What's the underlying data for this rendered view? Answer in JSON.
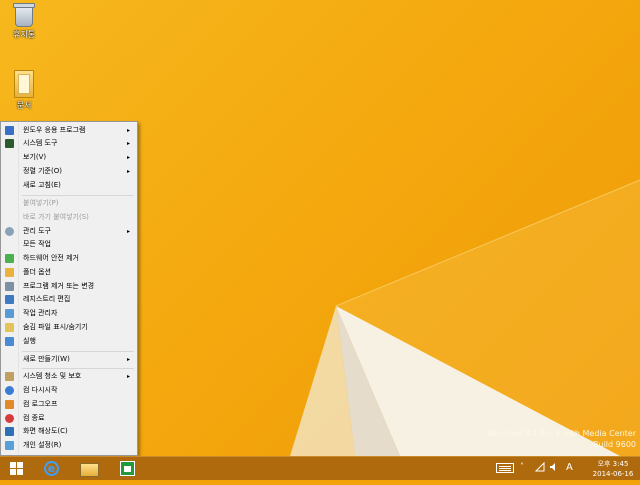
{
  "desktop": {
    "icons": [
      {
        "label": "휴지통",
        "icon": "recycle-bin-icon"
      },
      {
        "label": "문서",
        "icon": "folder-icon"
      }
    ],
    "watermark": [
      "Windows 8.1 Pro K with Media Center",
      "Build 9600"
    ]
  },
  "context_menu": {
    "items": [
      {
        "label": "윈도우 응용 프로그램",
        "icon": "windows-apps-icon",
        "submenu": true,
        "enabled": true
      },
      {
        "label": "시스템 도구",
        "icon": "system-tools-icon",
        "submenu": true,
        "enabled": true
      },
      {
        "label": "보기(V)",
        "submenu": true,
        "enabled": true
      },
      {
        "label": "정렬 기준(O)",
        "submenu": true,
        "enabled": true
      },
      {
        "label": "새로 고침(E)",
        "submenu": false,
        "enabled": true
      },
      {
        "label": "붙여넣기(P)",
        "submenu": false,
        "enabled": false
      },
      {
        "label": "바로 가기 붙여넣기(S)",
        "submenu": false,
        "enabled": false
      },
      {
        "label": "관리 도구",
        "icon": "admin-tools-icon",
        "submenu": true,
        "enabled": true
      },
      {
        "label": "모든 작업",
        "submenu": false,
        "enabled": true
      },
      {
        "label": "하드웨어 안전 제거",
        "icon": "safe-remove-hardware-icon",
        "submenu": false,
        "enabled": true
      },
      {
        "label": "폴더 옵션",
        "icon": "folder-options-icon",
        "submenu": false,
        "enabled": true
      },
      {
        "label": "프로그램 제거 또는 변경",
        "icon": "programs-icon",
        "submenu": false,
        "enabled": true
      },
      {
        "label": "레지스트리 편집",
        "icon": "registry-icon",
        "submenu": false,
        "enabled": true
      },
      {
        "label": "작업 관리자",
        "icon": "task-manager-icon",
        "submenu": false,
        "enabled": true
      },
      {
        "label": "숨김 파일 표시/숨기기",
        "icon": "hidden-files-icon",
        "submenu": false,
        "enabled": true
      },
      {
        "label": "실행",
        "icon": "run-icon",
        "submenu": false,
        "enabled": true
      },
      {
        "label": "새로 만들기(W)",
        "submenu": true,
        "enabled": true
      },
      {
        "label": "시스템 청소 및 보호",
        "icon": "shield-icon",
        "submenu": true,
        "enabled": true
      },
      {
        "label": "컴 다시시작",
        "icon": "restart-icon",
        "submenu": false,
        "enabled": true
      },
      {
        "label": "컴 로그오프",
        "icon": "logoff-icon",
        "submenu": false,
        "enabled": true
      },
      {
        "label": "컴 종료",
        "icon": "shutdown-icon",
        "submenu": false,
        "enabled": true
      },
      {
        "label": "화면 해상도(C)",
        "icon": "display-icon",
        "submenu": false,
        "enabled": true
      },
      {
        "label": "개인 설정(R)",
        "icon": "personalize-icon",
        "submenu": false,
        "enabled": true
      }
    ],
    "submenu_arrow": "▸"
  },
  "taskbar": {
    "pinned": [
      {
        "name": "start-button",
        "icon": "windows-logo-icon"
      },
      {
        "name": "internet-explorer",
        "icon": "ie-icon"
      },
      {
        "name": "file-explorer",
        "icon": "folder-icon"
      },
      {
        "name": "store",
        "icon": "store-icon"
      }
    ],
    "tray": {
      "chevron": "˄",
      "lang": "A",
      "time": "오후 3:45",
      "date": "2014-06-16"
    }
  },
  "colors": {
    "wallpaper": "#f4a90f",
    "taskbar": "#b06a0e",
    "menu_bg": "#f0f0f0"
  }
}
